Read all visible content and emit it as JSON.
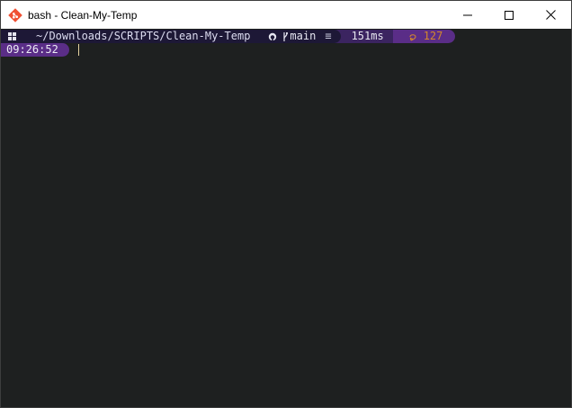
{
  "window": {
    "title": "bash - Clean-My-Temp"
  },
  "prompt": {
    "os_icon": "windows-icon",
    "path": "~/Downloads/SCRIPTS/Clean-My-Temp",
    "git_icon": "github-icon",
    "branch_icon": "git-branch-icon",
    "branch": "main",
    "status_symbol": "≡",
    "duration": "151ms",
    "exit_icon": "lightning-icon",
    "exit_code": "127",
    "time": "09:26:52"
  },
  "colors": {
    "terminal_bg": "#1e2020",
    "segment_dark": "#1d1836",
    "segment_mid": "#3b2460",
    "segment_purple": "#5a2d87",
    "exit_code": "#d4882c",
    "cursor": "#e6d3a0"
  }
}
